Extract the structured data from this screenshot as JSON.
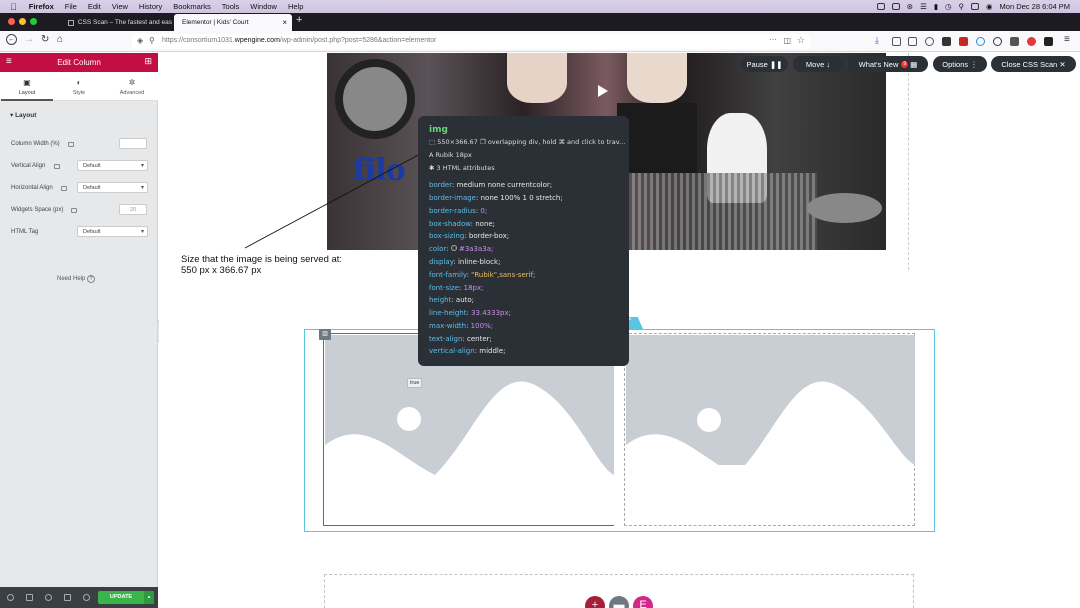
{
  "menubar": {
    "app": "Firefox",
    "items": [
      "File",
      "Edit",
      "View",
      "History",
      "Bookmarks",
      "Tools",
      "Window",
      "Help"
    ],
    "clock": "Mon Dec 28  6:04 PM"
  },
  "tabs": [
    {
      "title": "CSS Scan – The fastest and eas"
    },
    {
      "title": "Elementor | Kids' Court"
    }
  ],
  "url": {
    "prefix": "https://consortium1031.",
    "domain": "wpengine.com",
    "path": "/wp-admin/post.php?post=5286&action=elementor"
  },
  "panel": {
    "title": "Edit Column",
    "tabs": [
      {
        "label": "Layout"
      },
      {
        "label": "Style"
      },
      {
        "label": "Advanced"
      }
    ],
    "section": "Layout",
    "controls": {
      "column_width": {
        "label": "Column Width (%)",
        "value": ""
      },
      "vertical_align": {
        "label": "Vertical Align",
        "value": "Default"
      },
      "horizontal_align": {
        "label": "Horizontal Align",
        "value": "Default"
      },
      "widgets_space": {
        "label": "Widgets Space (px)",
        "value": "20"
      },
      "html_tag": {
        "label": "HTML Tag",
        "value": "Default"
      }
    },
    "need_help": "Need Help",
    "update_label": "UPDATE"
  },
  "cssscan": {
    "pause": "Pause",
    "move": "Move",
    "whats_new": "What's New",
    "badge": "9",
    "options": "Options",
    "close": "Close CSS Scan"
  },
  "tooltip": {
    "tag": "img",
    "size": "550×366.67",
    "hint": "overlapping div, hold ⌘ and click to trav...",
    "font": "Rubik 18px",
    "attrs": "3 HTML attributes",
    "props": [
      {
        "name": "border",
        "value": "medium none currentcolor;"
      },
      {
        "name": "border-image",
        "value": "none 100% 1 0 stretch;"
      },
      {
        "name": "border-radius",
        "value": "0;"
      },
      {
        "name": "box-shadow",
        "value": "none;"
      },
      {
        "name": "box-sizing",
        "value": "border-box;"
      },
      {
        "name": "color",
        "value": "#3a3a3a;"
      },
      {
        "name": "display",
        "value": "inline-block;"
      },
      {
        "name": "font-family",
        "value": "\"Rubik\",sans-serif;"
      },
      {
        "name": "font-size",
        "value": "18px;"
      },
      {
        "name": "height",
        "value": "auto;"
      },
      {
        "name": "line-height",
        "value": "33.4333px;"
      },
      {
        "name": "max-width",
        "value": "100%;"
      },
      {
        "name": "text-align",
        "value": "center;"
      },
      {
        "name": "vertical-align",
        "value": "middle;"
      }
    ]
  },
  "annotation": {
    "line1": "Size that the image is being served at:",
    "line2": "550 px x 366.67 px"
  },
  "true_label": "true",
  "colors": {
    "elementor_red": "#c20e43",
    "section_cyan": "#58c6e0",
    "update_green": "#39b54a",
    "tooltip_bg": "#2b2f36"
  }
}
